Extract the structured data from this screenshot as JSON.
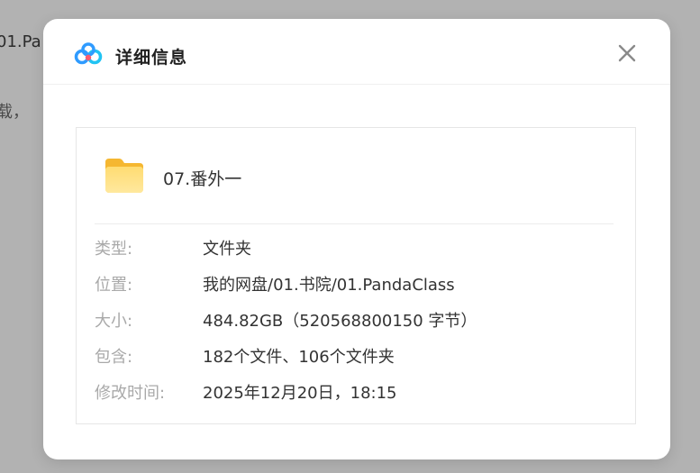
{
  "background": {
    "line1": "01.Pa",
    "line2": "载，"
  },
  "dialog": {
    "title": "详细信息",
    "close_icon": "close-icon"
  },
  "file": {
    "name": "07.番外一",
    "icon": "folder-icon"
  },
  "details": [
    {
      "label": "类型:",
      "value": "文件夹"
    },
    {
      "label": "位置:",
      "value": "我的网盘/01.书院/01.PandaClass"
    },
    {
      "label": "大小:",
      "value": "484.82GB（520568800150 字节）"
    },
    {
      "label": "包含:",
      "value": "182个文件、106个文件夹"
    },
    {
      "label": "修改时间:",
      "value": "2025年12月20日，18:15"
    }
  ],
  "colors": {
    "overlay": "#b2b2b2",
    "folder": "#f9c94a",
    "logo_blue": "#2f9bff",
    "logo_red": "#ff5a6e",
    "label_gray": "#a9a9a9"
  }
}
